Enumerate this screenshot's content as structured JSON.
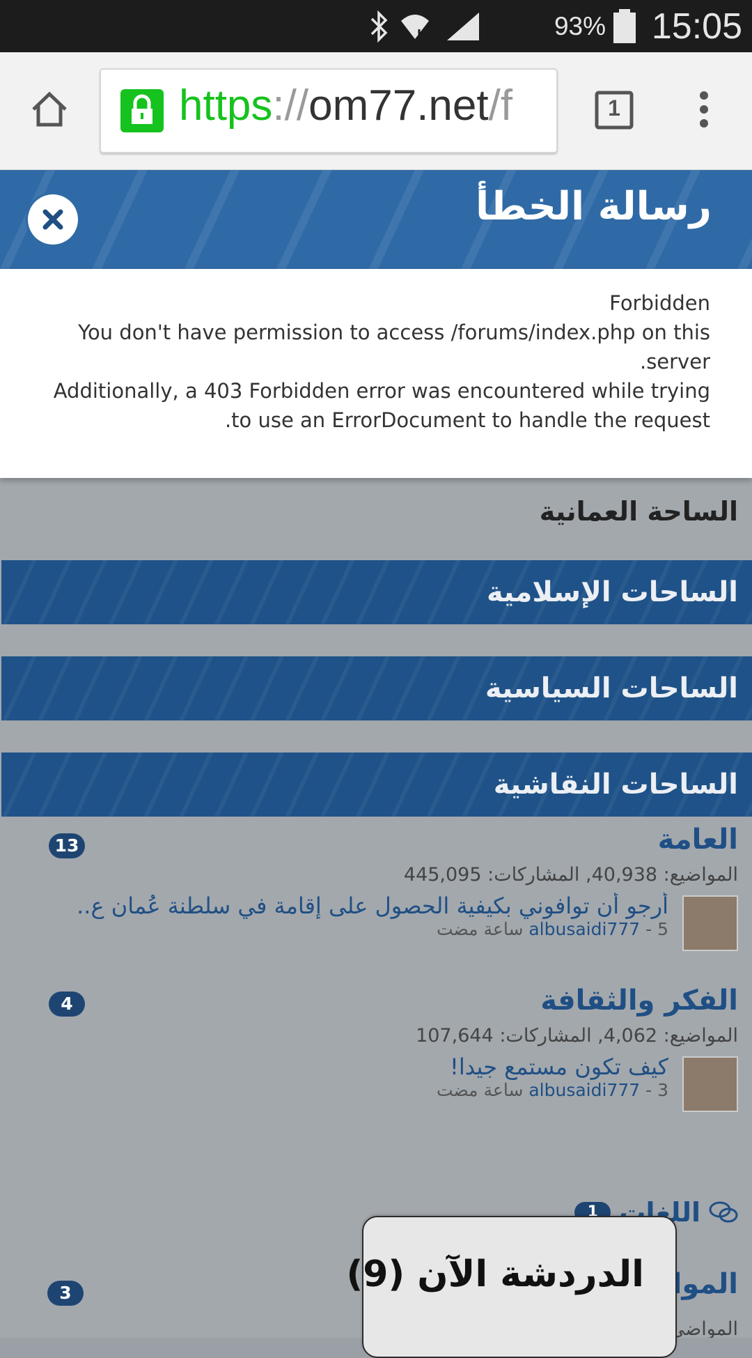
{
  "status_bar": {
    "time": "15:05",
    "battery_percent": "93%",
    "icons": [
      "bluetooth-icon",
      "wifi-icon",
      "signal-icon",
      "battery-icon"
    ]
  },
  "browser": {
    "url_scheme": "https",
    "url_sep": "://",
    "url_host": "om77.net",
    "url_path": "/f",
    "tab_count": "1"
  },
  "dialog": {
    "title": "رسالة الخطأ",
    "line1": "Forbidden",
    "line2": "You don't have permission to access /forums/index.php on this server.",
    "line3": "Additionally, a 403 Forbidden error was encountered while trying to use an ErrorDocument to handle the request."
  },
  "forum": {
    "section_title": "الساحة العمانية",
    "categories": [
      "الساحات الإسلامية",
      "الساحات السياسية",
      "الساحات النقاشية"
    ],
    "forums": [
      {
        "title": "العامة",
        "stats": "المواضيع: 40,938, المشاركات: 445,095",
        "badge": "13",
        "last_post_title": "أرجو أن توافوني بكيفية الحصول على إقامة في سلطنة عُمان ع..",
        "last_post_author": "albusaidi777",
        "last_post_time": "5 ساعة مضت"
      },
      {
        "title": "الفكر والثقافة",
        "stats": "المواضيع: 4,062, المشاركات: 107,644",
        "badge": "4",
        "last_post_title": "كيف تكون مستمع جيدا!",
        "last_post_author": "albusaidi777",
        "last_post_time": "3 ساعة مضت"
      }
    ],
    "subforum_label": "اللغات",
    "subforum_badge": "1",
    "third_forum_title": "الموا",
    "third_forum_badge": "3",
    "third_forum_stats": "المواضي"
  },
  "chat": {
    "label": "الدردشة الآن (9)"
  },
  "colors": {
    "header_blue": "#2f6aa6",
    "category_blue": "#1f5288",
    "secure_green": "#16c21d"
  }
}
